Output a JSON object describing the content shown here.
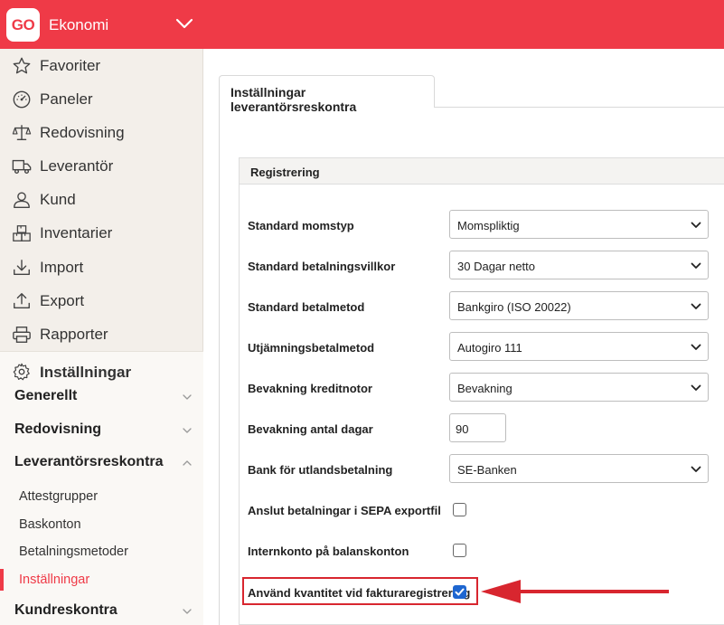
{
  "topbar": {
    "logo_text": "GO",
    "title": "Ekonomi",
    "accent": "#ef3a47"
  },
  "sidebar": {
    "items": [
      {
        "label": "Favoriter",
        "icon": "star-icon"
      },
      {
        "label": "Paneler",
        "icon": "gauge-icon"
      },
      {
        "label": "Redovisning",
        "icon": "scales-icon"
      },
      {
        "label": "Leverantör",
        "icon": "truck-icon"
      },
      {
        "label": "Kund",
        "icon": "person-icon"
      },
      {
        "label": "Inventarier",
        "icon": "boxes-icon"
      },
      {
        "label": "Import",
        "icon": "import-icon"
      },
      {
        "label": "Export",
        "icon": "export-icon"
      },
      {
        "label": "Rapporter",
        "icon": "printer-icon"
      }
    ],
    "settings": {
      "label": "Inställningar",
      "groups": [
        {
          "label": "Generellt",
          "expanded": false
        },
        {
          "label": "Redovisning",
          "expanded": false
        },
        {
          "label": "Leverantörsreskontra",
          "expanded": true
        },
        {
          "label": "Kundreskontra",
          "expanded": false
        }
      ],
      "sub_items": [
        {
          "label": "Attestgrupper",
          "active": false
        },
        {
          "label": "Baskonton",
          "active": false
        },
        {
          "label": "Betalningsmetoder",
          "active": false
        },
        {
          "label": "Inställningar",
          "active": true
        }
      ]
    }
  },
  "main": {
    "tab_label": "Inställningar leverantörsreskontra",
    "section_title": "Registrering",
    "fields": [
      {
        "label": "Standard momstyp",
        "type": "select",
        "value": "Momspliktig"
      },
      {
        "label": "Standard betalningsvillkor",
        "type": "select",
        "value": "30 Dagar netto"
      },
      {
        "label": "Standard betalmetod",
        "type": "select",
        "value": "Bankgiro (ISO 20022)"
      },
      {
        "label": "Utjämningsbetalmetod",
        "type": "select",
        "value": "Autogiro 111"
      },
      {
        "label": "Bevakning kreditnotor",
        "type": "select",
        "value": "Bevakning"
      },
      {
        "label": "Bevakning antal dagar",
        "type": "number",
        "value": "90"
      },
      {
        "label": "Bank för utlandsbetalning",
        "type": "select",
        "value": "SE-Banken"
      },
      {
        "label": "Anslut betalningar i SEPA exportfil",
        "type": "checkbox",
        "checked": false
      },
      {
        "label": "Internkonto på balanskonton",
        "type": "checkbox",
        "checked": false
      },
      {
        "label": "Använd kvantitet vid fakturaregistrering",
        "type": "checkbox",
        "checked": true
      }
    ]
  }
}
